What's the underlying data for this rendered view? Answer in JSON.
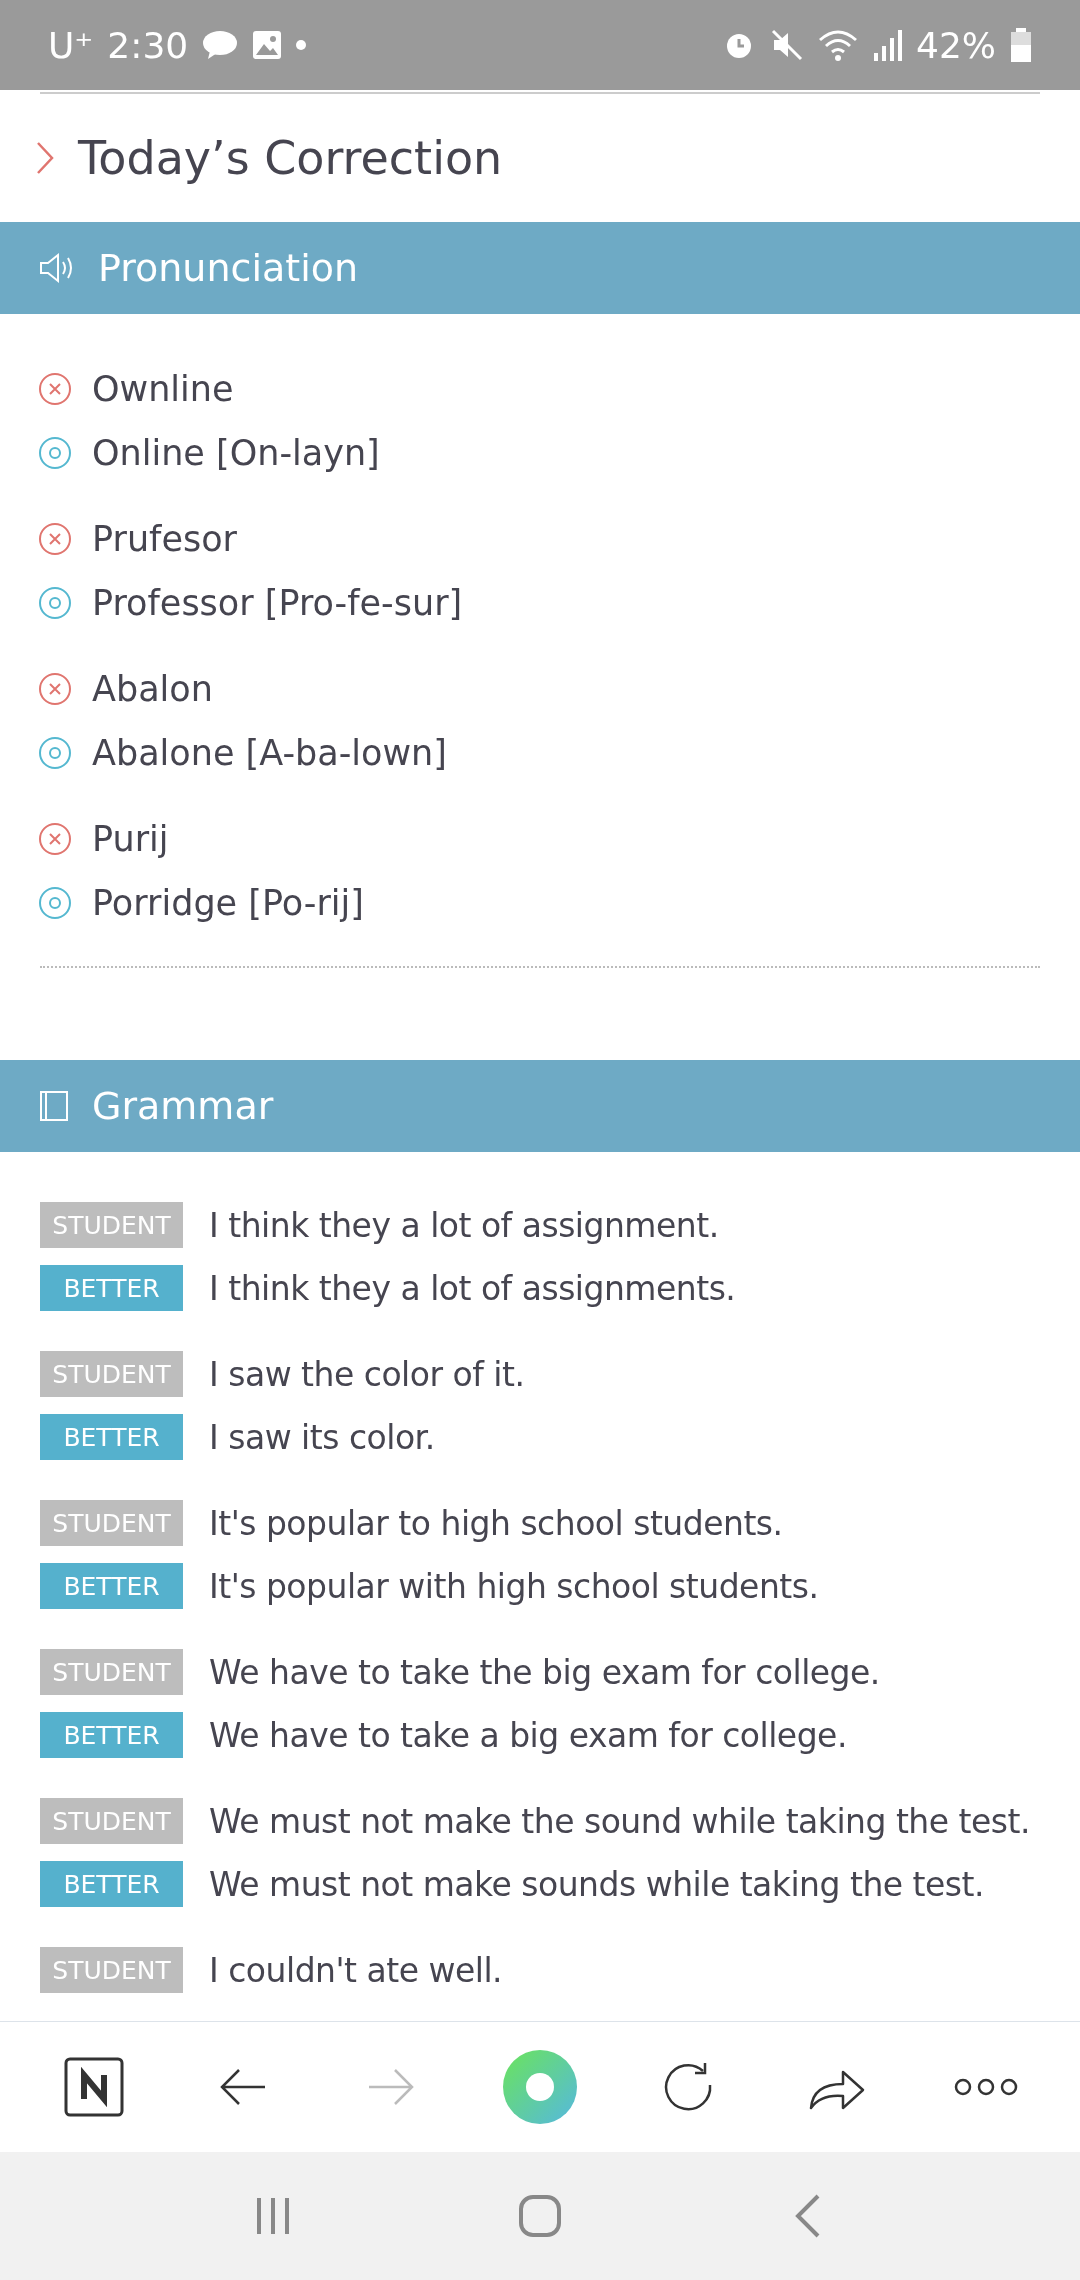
{
  "status_bar": {
    "carrier": "U⁺",
    "time": "2:30",
    "battery": "42%"
  },
  "title": "Today’s Correction",
  "pronunciation": {
    "heading": "Pronunciation",
    "items": [
      {
        "wrong": "Ownline",
        "right": "Online [On-layn]"
      },
      {
        "wrong": "Prufesor",
        "right": "Professor [Pro-fe-sur]"
      },
      {
        "wrong": "Abalon",
        "right": "Abalone [A-ba-lown]"
      },
      {
        "wrong": "Purij",
        "right": "Porridge [Po-rij]"
      }
    ]
  },
  "grammar": {
    "heading": "Grammar",
    "items": [
      {
        "student_label": "STUDENT",
        "student": "I think they a lot of assignment.",
        "better_label": "BETTER",
        "better": "I think they a lot of assignments."
      },
      {
        "student_label": "STUDENT",
        "student": "I saw the color of it.",
        "better_label": "BETTER",
        "better": "I saw its color."
      },
      {
        "student_label": "STUDENT",
        "student": "It's popular to high school students.",
        "better_label": "BETTER",
        "better": "It's popular with high school students."
      },
      {
        "student_label": "STUDENT",
        "student": "We have to take the big exam for college.",
        "better_label": "BETTER",
        "better": "We have to take a big exam for college."
      },
      {
        "student_label": "STUDENT",
        "student": "We must not make the sound while taking the test.",
        "better_label": "BETTER",
        "better": "We must not make sounds while taking the test."
      },
      {
        "student_label": "STUDENT",
        "student": "I couldn't ate well."
      }
    ]
  },
  "toolbar": {
    "forward_disabled": true
  }
}
